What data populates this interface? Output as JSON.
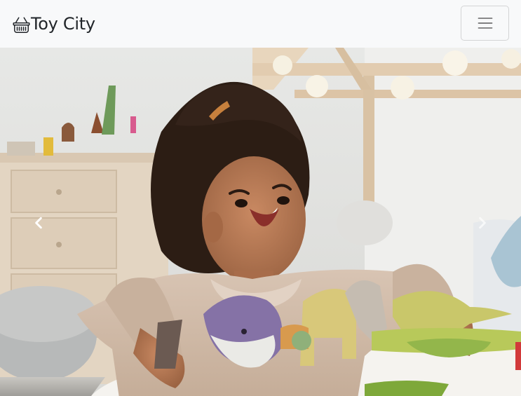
{
  "navbar": {
    "brand_text": "Toy City",
    "brand_icon": "basket-icon",
    "toggler_icon": "hamburger-menu-icon"
  },
  "carousel": {
    "prev_icon": "chevron-left-icon",
    "next_icon": "chevron-right-icon",
    "slide_image": "photo"
  },
  "colors": {
    "navbar_bg": "#f8f9fa",
    "brand_text": "#212529",
    "toggler_border": "#d3d4d5",
    "toggler_bars": "#6c757d"
  }
}
